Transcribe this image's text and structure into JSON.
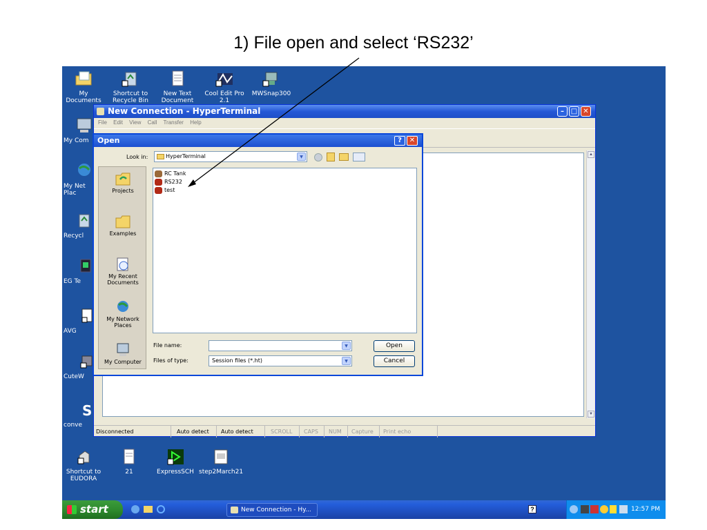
{
  "caption": "1) File open and select ‘RS232’",
  "desktop_icons": [
    {
      "label": "My Documents",
      "icon": "folder-documents-icon"
    },
    {
      "label": "Shortcut to Recycle Bin",
      "icon": "recycle-bin-shortcut-icon"
    },
    {
      "label": "New Text Document (2)",
      "icon": "text-document-icon"
    },
    {
      "label": "Cool Edit Pro 2.1",
      "icon": "cool-edit-icon"
    },
    {
      "label": "MWSnap300",
      "icon": "mwsnap-icon"
    },
    {
      "label": "My Com",
      "icon": "my-computer-icon"
    },
    {
      "label": "My Net Plac",
      "icon": "network-icon"
    },
    {
      "label": "Recycl",
      "icon": "recycle-bin-icon"
    },
    {
      "label": "EG Te",
      "icon": "app-icon"
    },
    {
      "label": "AVG",
      "icon": "shortcut-icon"
    },
    {
      "label": "CuteW",
      "icon": "cuteftp-icon"
    },
    {
      "label": "conve",
      "icon": "converter-icon"
    },
    {
      "label": "Shortcut to EUDORA",
      "icon": "eudora-icon"
    },
    {
      "label": "21",
      "icon": "text-document-icon"
    },
    {
      "label": "ExpressSCH",
      "icon": "expresssch-icon"
    },
    {
      "label": "step2March21",
      "icon": "image-file-icon"
    }
  ],
  "hyperterminal": {
    "title": "New Connection - HyperTerminal",
    "menu": [
      "File",
      "Edit",
      "View",
      "Call",
      "Transfer",
      "Help"
    ],
    "status": [
      "Disconnected",
      "Auto detect",
      "Auto detect",
      "SCROLL",
      "CAPS",
      "NUM",
      "Capture",
      "Print echo"
    ]
  },
  "open_dialog": {
    "title": "Open",
    "look_in_label": "Look in:",
    "look_in_value": "HyperTerminal",
    "places": [
      "Projects",
      "Examples",
      "My Recent Documents",
      "My Network Places",
      "My Computer"
    ],
    "files": [
      "RC Tank",
      "RS232",
      "test"
    ],
    "file_name_label": "File name:",
    "file_name_value": "",
    "files_of_type_label": "Files of type:",
    "files_of_type_value": "Session files (*.ht)",
    "open_button": "Open",
    "cancel_button": "Cancel"
  },
  "taskbar": {
    "start_label": "start",
    "task_label": "New Connection - Hy...",
    "clock": "12:57 PM"
  },
  "colors": {
    "desktop": "#1e53a0",
    "titlebar": "#2558d6",
    "dialog_bg": "#ece9d8",
    "start_green": "#2e8b2e"
  }
}
